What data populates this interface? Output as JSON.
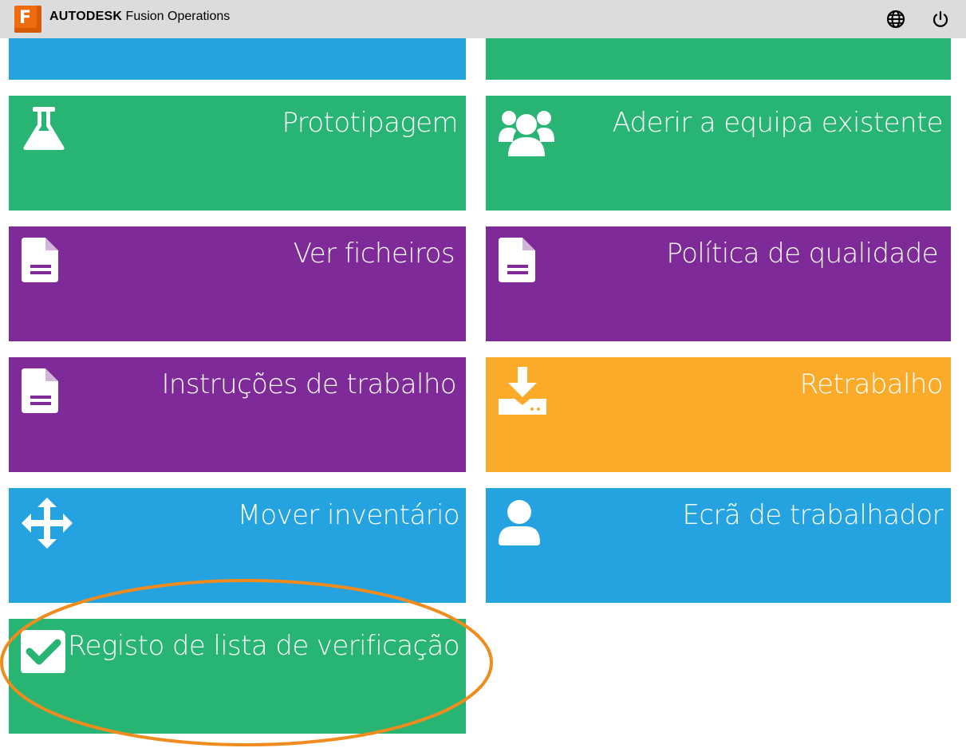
{
  "header": {
    "logo_letter": "F",
    "brand_name": "AUTODESK",
    "product_name": "Fusion Operations",
    "language_icon": "globe-icon",
    "logout_icon": "power-icon"
  },
  "tiles": [
    {
      "label": "",
      "color": "#25a3e0",
      "icon": "none"
    },
    {
      "label": "",
      "color": "#28b573",
      "icon": "none"
    },
    {
      "label": "Prototipagem",
      "color": "#28b573",
      "icon": "flask-icon"
    },
    {
      "label": "Aderir a equipa existente",
      "color": "#28b573",
      "icon": "users-icon"
    },
    {
      "label": "Ver ficheiros",
      "color": "#7e2a98",
      "icon": "file-icon"
    },
    {
      "label": "Política de qualidade",
      "color": "#7e2a98",
      "icon": "file-icon"
    },
    {
      "label": "Instruções de trabalho",
      "color": "#7e2a98",
      "icon": "file-icon"
    },
    {
      "label": "Retrabalho",
      "color": "#fbab29",
      "icon": "download-tray-icon"
    },
    {
      "label": "Mover inventário",
      "color": "#25a3e0",
      "icon": "move-arrows-icon"
    },
    {
      "label": "Ecrã de trabalhador",
      "color": "#25a3e0",
      "icon": "user-icon"
    },
    {
      "label": "Registo de lista de verificação",
      "color": "#28b573",
      "icon": "checkbox-icon"
    }
  ],
  "annotation": {
    "highlight_color": "#f08c1e",
    "highlighted_tile": "Registo de lista de verificação"
  }
}
